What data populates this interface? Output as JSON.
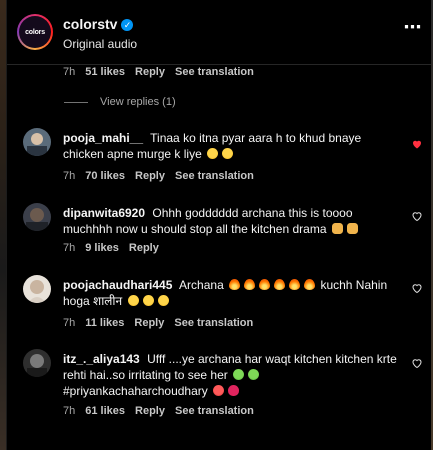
{
  "header": {
    "account": "colorstv",
    "avatar_text": "colors",
    "subtitle": "Original audio",
    "more_icon": "more-horizontal-icon"
  },
  "top_meta": {
    "time": "7h",
    "likes": "51 likes",
    "reply": "Reply",
    "translate": "See translation"
  },
  "view_replies": "View replies (1)",
  "comments": [
    {
      "user": "pooja_mahi__",
      "text": "Tinaa ko itna pyar aara h to khud bnaye chicken apne murge k liye",
      "emojis": [
        "laughing",
        "laughing"
      ],
      "time": "7h",
      "likes": "70 likes",
      "reply": "Reply",
      "translate": "See translation",
      "liked": true
    },
    {
      "user": "dipanwita6920",
      "text": "Ohhh godddddd archana this is toooo muchhhh now u should stop all the kitchen drama",
      "emojis": [
        "folded-hands",
        "folded-hands"
      ],
      "time": "7h",
      "likes": "9 likes",
      "reply": "Reply",
      "liked": false
    },
    {
      "user": "poojachaudhari445",
      "text_a": "Archana",
      "text_b": "kuchh Nahin hoga शालीन",
      "emojis_a": [
        "fire",
        "fire",
        "fire",
        "fire",
        "fire",
        "fire"
      ],
      "emojis_b": [
        "laughing",
        "laughing",
        "laughing"
      ],
      "time": "7h",
      "likes": "11 likes",
      "reply": "Reply",
      "translate": "See translation",
      "liked": false
    },
    {
      "user": "itz_._aliya143",
      "text_a": "Ufff ....ye archana har waqt kitchen kitchen krte rehti hai..so irritating to see her",
      "emojis_a": [
        "nauseated",
        "sick"
      ],
      "text_b": "#priyankachaharchoudhary",
      "emojis_b": [
        "angry",
        "red-heart"
      ],
      "time": "7h",
      "likes": "61 likes",
      "reply": "Reply",
      "translate": "See translation",
      "liked": false
    }
  ],
  "colors": {
    "accent_like": "#ff3040",
    "verified": "#0095f6",
    "muted": "#a8a8a8"
  }
}
